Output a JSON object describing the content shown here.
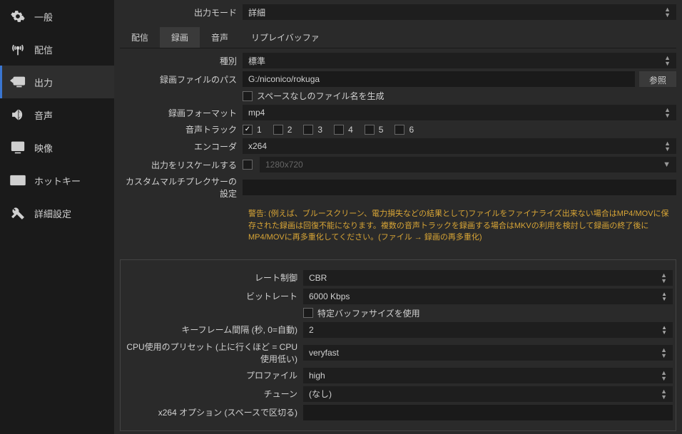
{
  "sidebar": {
    "items": [
      {
        "label": "一般",
        "icon": "gear"
      },
      {
        "label": "配信",
        "icon": "broadcast"
      },
      {
        "label": "出力",
        "icon": "output"
      },
      {
        "label": "音声",
        "icon": "speaker"
      },
      {
        "label": "映像",
        "icon": "monitor"
      },
      {
        "label": "ホットキー",
        "icon": "keyboard"
      },
      {
        "label": "詳細設定",
        "icon": "tools"
      }
    ]
  },
  "output_mode": {
    "label": "出力モード",
    "value": "詳細"
  },
  "tabs": {
    "items": [
      "配信",
      "録画",
      "音声",
      "リプレイバッファ"
    ],
    "active_index": 1
  },
  "recording": {
    "type": {
      "label": "種別",
      "value": "標準"
    },
    "path": {
      "label": "録画ファイルのパス",
      "value": "G:/niconico/rokuga",
      "browse": "参照"
    },
    "nospace": {
      "label": "スペースなしのファイル名を生成",
      "checked": false
    },
    "format": {
      "label": "録画フォーマット",
      "value": "mp4"
    },
    "tracks": {
      "label": "音声トラック",
      "values": [
        "1",
        "2",
        "3",
        "4",
        "5",
        "6"
      ],
      "checked": [
        true,
        false,
        false,
        false,
        false,
        false
      ]
    },
    "encoder": {
      "label": "エンコーダ",
      "value": "x264"
    },
    "rescale": {
      "label": "出力をリスケールする",
      "checked": false,
      "value": "1280x720"
    },
    "mux": {
      "label": "カスタムマルチプレクサーの設定",
      "value": ""
    }
  },
  "warning_text": "警告: (例えば、ブルースクリーン、電力損失などの結果として)ファイルをファイナライズ出来ない場合はMP4/MOVに保存された録画は回復不能になります。複数の音声トラックを録画する場合はMKVの利用を検討して録画の終了後にMP4/MOVに再多重化してください。(ファイル → 録画の再多重化)",
  "encoder_settings": {
    "rate_control": {
      "label": "レート制御",
      "value": "CBR"
    },
    "bitrate": {
      "label": "ビットレート",
      "value": "6000 Kbps"
    },
    "custom_buf": {
      "label": "特定バッファサイズを使用",
      "checked": false
    },
    "keyframe": {
      "label": "キーフレーム間隔 (秒, 0=自動)",
      "value": "2"
    },
    "preset": {
      "label": "CPU使用のプリセット (上に行くほど = CPU使用低い)",
      "value": "veryfast"
    },
    "profile": {
      "label": "プロファイル",
      "value": "high"
    },
    "tune": {
      "label": "チューン",
      "value": "(なし)"
    },
    "x264opts": {
      "label": "x264 オプション (スペースで区切る)",
      "value": ""
    }
  }
}
